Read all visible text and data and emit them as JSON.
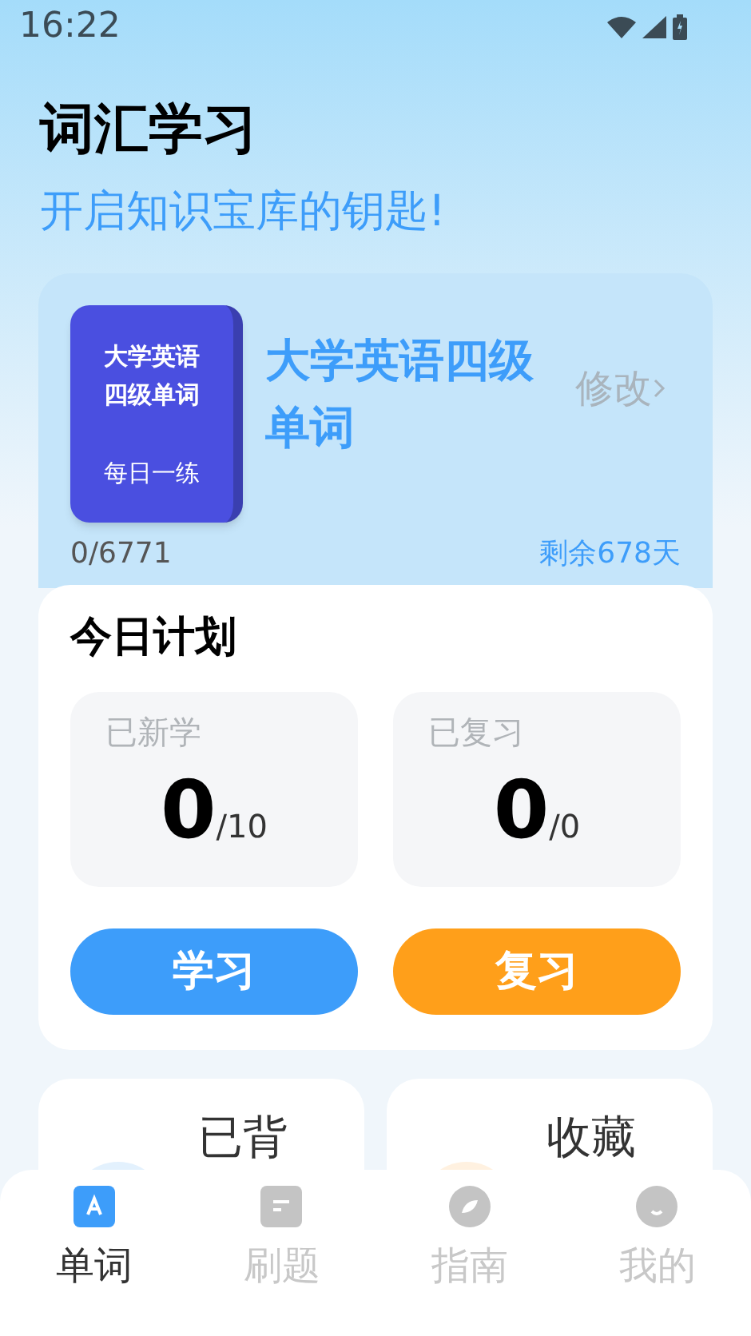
{
  "status_bar": {
    "time": "16:22"
  },
  "header": {
    "title": "词汇学习",
    "subtitle": "开启知识宝库的钥匙!"
  },
  "book": {
    "cover_title": "大学英语四级单词",
    "cover_caption": "每日一练",
    "name": "大学英语四级单词",
    "edit_link": "修改",
    "progress": "0/6771",
    "remaining": "剩余678天"
  },
  "plan": {
    "title": "今日计划",
    "stats": [
      {
        "label": "已新学",
        "value": "0",
        "total": "/10"
      },
      {
        "label": "已复习",
        "value": "0",
        "total": "/0"
      }
    ],
    "buttons": [
      {
        "label": "学习",
        "kind": "study"
      },
      {
        "label": "复习",
        "kind": "review"
      }
    ]
  },
  "shortcuts": [
    {
      "label": "已背",
      "kind": "learned"
    },
    {
      "label": "收藏",
      "kind": "favorites"
    }
  ],
  "tabs": [
    {
      "label": "单词",
      "kind": "words",
      "selected": true
    },
    {
      "label": "刷题",
      "kind": "quiz",
      "selected": false
    },
    {
      "label": "指南",
      "kind": "guide",
      "selected": false
    },
    {
      "label": "我的",
      "kind": "profile",
      "selected": false
    }
  ]
}
